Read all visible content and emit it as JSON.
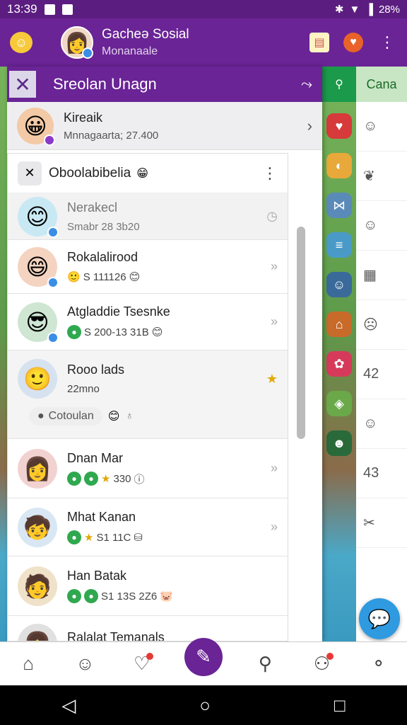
{
  "status": {
    "time": "13:39",
    "battery": "28%"
  },
  "header": {
    "title": "Gacheə Sosial",
    "subtitle": "Monanaale"
  },
  "drawer": {
    "title": "Sreolan Unagn"
  },
  "profile": {
    "name": "Kireaik",
    "sub": "Mnnagaarta; 27.400"
  },
  "card": {
    "title": "Oboolabibelia"
  },
  "contacts": [
    {
      "name": "Nerakecl",
      "meta": "Smabr 28 3b20",
      "avatar_color": "#c8e8f4"
    },
    {
      "name": "Rokalalirood",
      "meta": "S 111126",
      "avatar_color": "#f4d3c0"
    },
    {
      "name": "Atgladdie Tsesnke",
      "meta": "S 200-13 31B",
      "avatar_color": "#cfe6d2"
    },
    {
      "name": "Rooo lads",
      "meta": "22mno",
      "avatar_color": "#d7e2f0"
    },
    {
      "name": "Dnan Mar",
      "meta": "330",
      "avatar_color": "#f2d2d0"
    },
    {
      "name": "Mhat Kanan",
      "meta": "S1 11C",
      "avatar_color": "#d9e7f4"
    },
    {
      "name": "Han Batak",
      "meta": "S1 13S 2Z6",
      "avatar_color": "#f0e2c9"
    },
    {
      "name": "Ralalat Temanals",
      "meta": "",
      "avatar_color": "#e0e0e0"
    }
  ],
  "chip": {
    "label": "Cotoulan"
  },
  "right_panel": {
    "button": "Cana",
    "numbers": [
      "42",
      "43"
    ]
  }
}
